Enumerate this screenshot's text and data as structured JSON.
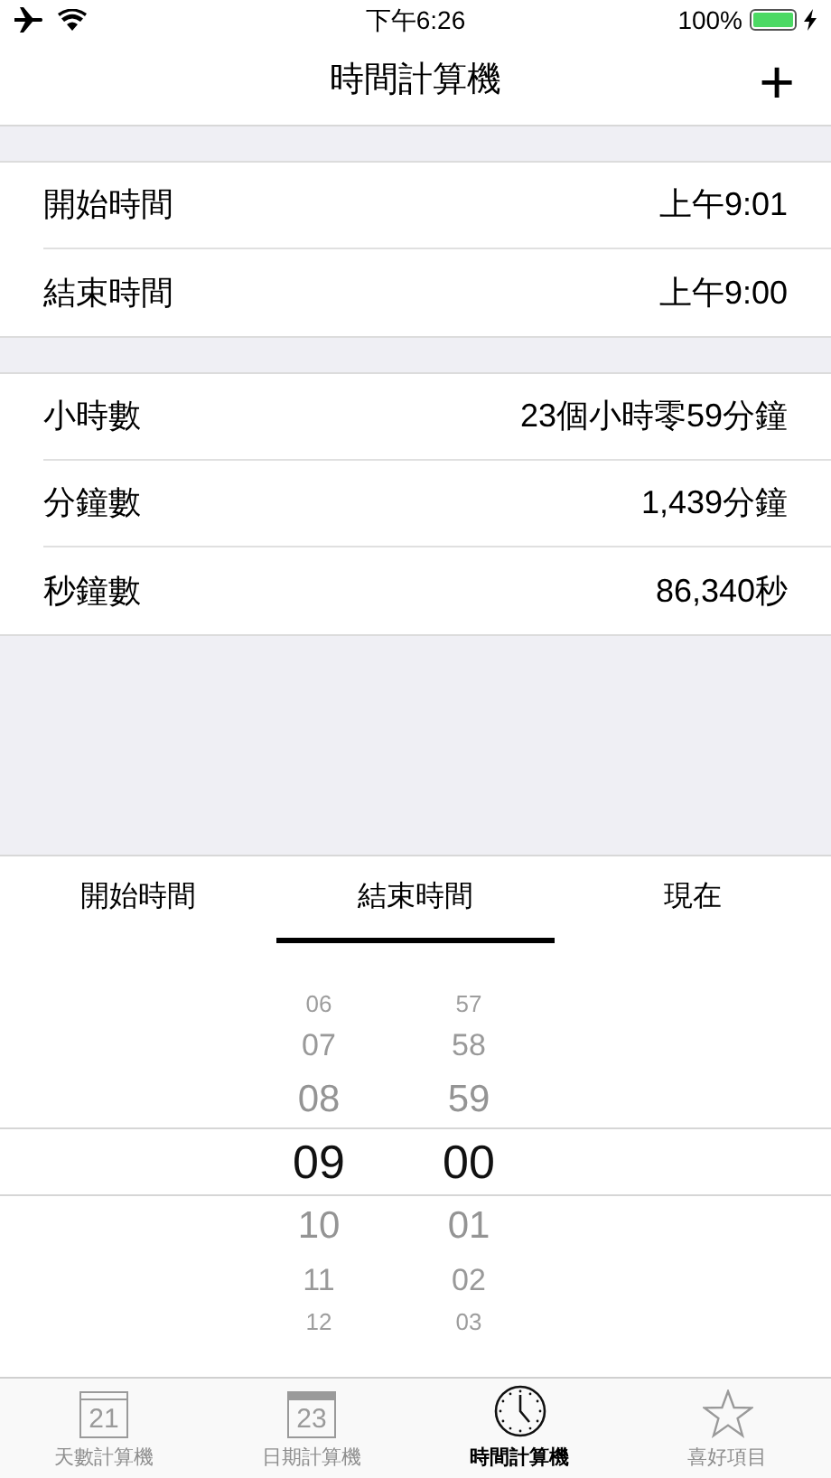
{
  "status_bar": {
    "time": "下午6:26",
    "battery_text": "100%",
    "battery": {
      "level": 1
    }
  },
  "nav": {
    "title": "時間計算機",
    "add": "+"
  },
  "inputs": [
    {
      "label": "開始時間",
      "value": "上午9:01"
    },
    {
      "label": "結束時間",
      "value": "上午9:00"
    }
  ],
  "results": [
    {
      "label": "小時數",
      "value": "23個小時零59分鐘"
    },
    {
      "label": "分鐘數",
      "value": "1,439分鐘"
    },
    {
      "label": "秒鐘數",
      "value": "86,340秒"
    }
  ],
  "segments": [
    {
      "label": "開始時間",
      "selected": false
    },
    {
      "label": "結束時間",
      "selected": true
    },
    {
      "label": "現在",
      "selected": false
    }
  ],
  "picker": {
    "columns": [
      {
        "items": [
          {
            "text": "06",
            "selected": false
          },
          {
            "text": "07",
            "selected": false
          },
          {
            "text": "08",
            "selected": false
          },
          {
            "text": "09",
            "selected": true
          },
          {
            "text": "10",
            "selected": false
          },
          {
            "text": "11",
            "selected": false
          },
          {
            "text": "12",
            "selected": false
          }
        ]
      },
      {
        "items": [
          {
            "text": "57",
            "selected": false
          },
          {
            "text": "58",
            "selected": false
          },
          {
            "text": "59",
            "selected": false
          },
          {
            "text": "00",
            "selected": true
          },
          {
            "text": "01",
            "selected": false
          },
          {
            "text": "02",
            "selected": false
          },
          {
            "text": "03",
            "selected": false
          }
        ]
      }
    ]
  },
  "tab_bar": [
    {
      "kind": "calendar",
      "icon_text": "21",
      "label": "天數計算機",
      "selected": false
    },
    {
      "kind": "calendar-bound",
      "icon_text": "23",
      "label": "日期計算機",
      "selected": false
    },
    {
      "kind": "clock",
      "label": "時間計算機",
      "selected": true
    },
    {
      "kind": "star",
      "label": "喜好項目",
      "selected": false
    }
  ]
}
